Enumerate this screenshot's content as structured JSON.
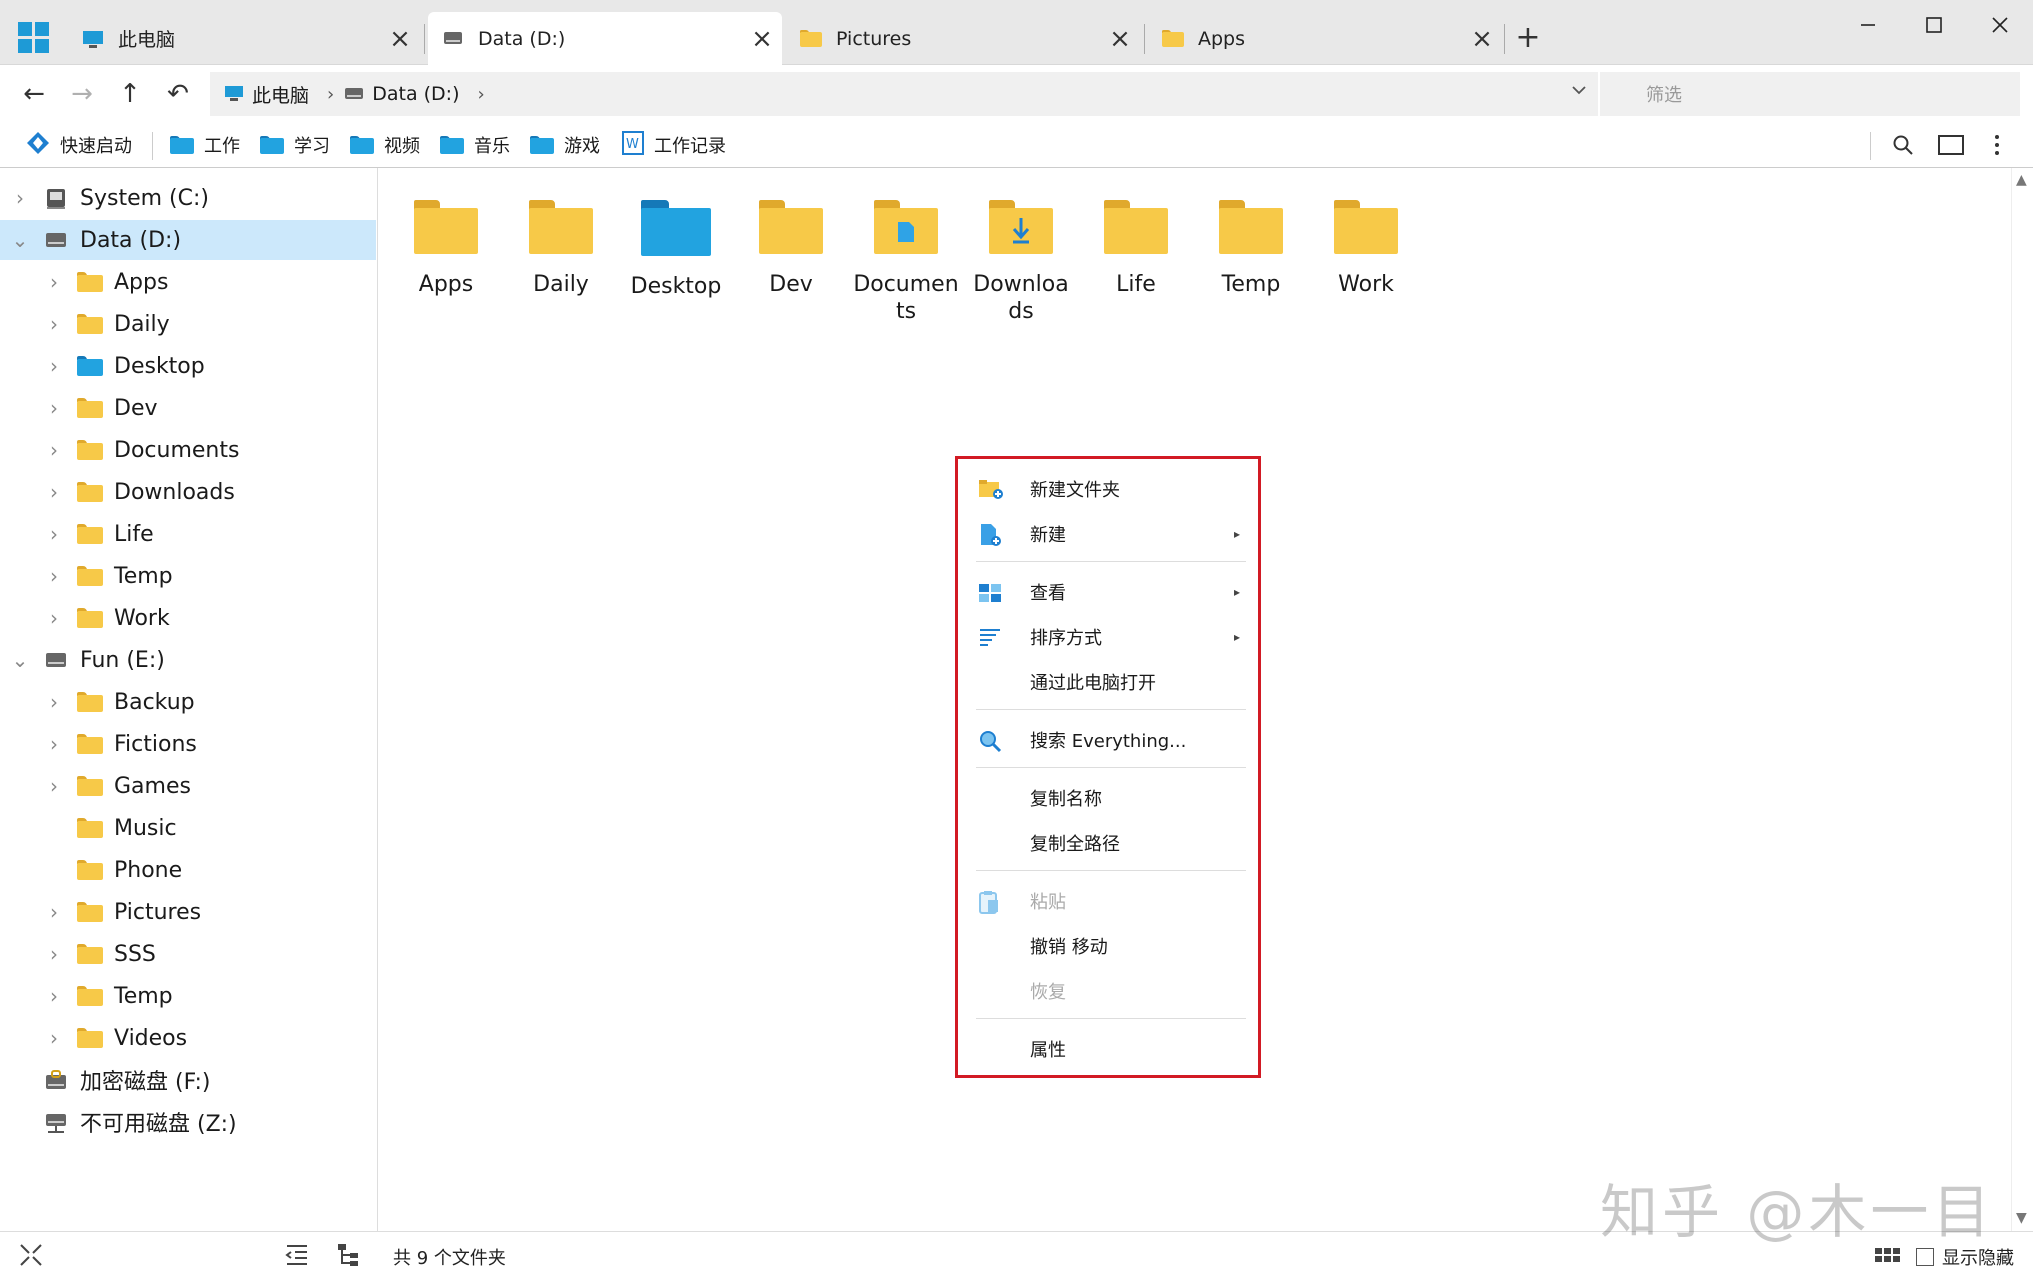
{
  "tabs": [
    {
      "label": "此电脑",
      "icon": "computer-icon"
    },
    {
      "label": "Data (D:)",
      "icon": "drive-icon"
    },
    {
      "label": "Pictures",
      "icon": "pictures-folder-icon"
    },
    {
      "label": "Apps",
      "icon": "folder-icon"
    }
  ],
  "window": {
    "minimize": "—",
    "maximize": "☐",
    "close": "✕",
    "new_tab": "+"
  },
  "nav": {
    "back": "←",
    "forward": "→",
    "up": "↑",
    "undo": "↶"
  },
  "address": {
    "crumbs": [
      "此电脑",
      "Data (D:)"
    ],
    "sep": "›",
    "dropdown": "⌄"
  },
  "filter": {
    "placeholder": "筛选"
  },
  "quickbar": {
    "launch": "快速启动",
    "items": [
      "工作",
      "学习",
      "视频",
      "音乐",
      "游戏",
      "工作记录"
    ]
  },
  "sidebar": {
    "nodes": [
      {
        "label": "System (C:)"
      },
      {
        "label": "Data (D:)"
      },
      {
        "label": "Apps"
      },
      {
        "label": "Daily"
      },
      {
        "label": "Desktop"
      },
      {
        "label": "Dev"
      },
      {
        "label": "Documents"
      },
      {
        "label": "Downloads"
      },
      {
        "label": "Life"
      },
      {
        "label": "Temp"
      },
      {
        "label": "Work"
      },
      {
        "label": "Fun (E:)"
      },
      {
        "label": "Backup"
      },
      {
        "label": "Fictions"
      },
      {
        "label": "Games"
      },
      {
        "label": "Music"
      },
      {
        "label": "Phone"
      },
      {
        "label": "Pictures"
      },
      {
        "label": "SSS"
      },
      {
        "label": "Temp"
      },
      {
        "label": "Videos"
      },
      {
        "label": "加密磁盘 (F:)"
      },
      {
        "label": "不可用磁盘 (Z:)"
      }
    ]
  },
  "files": [
    {
      "line1": "Apps",
      "line2": ""
    },
    {
      "line1": "Daily",
      "line2": ""
    },
    {
      "line1": "Desktop",
      "line2": ""
    },
    {
      "line1": "Dev",
      "line2": ""
    },
    {
      "line1": "Documen",
      "line2": "ts"
    },
    {
      "line1": "Downloa",
      "line2": "ds"
    },
    {
      "line1": "Life",
      "line2": ""
    },
    {
      "line1": "Temp",
      "line2": ""
    },
    {
      "line1": "Work",
      "line2": ""
    }
  ],
  "context_menu": {
    "items": [
      {
        "label": "新建文件夹"
      },
      {
        "label": "新建"
      },
      {
        "label": "查看"
      },
      {
        "label": "排序方式"
      },
      {
        "label": "通过此电脑打开"
      },
      {
        "label": "搜索 Everything..."
      },
      {
        "label": "复制名称"
      },
      {
        "label": "复制全路径"
      },
      {
        "label": "粘贴"
      },
      {
        "label": "撤销 移动"
      },
      {
        "label": "恢复"
      },
      {
        "label": "属性"
      }
    ],
    "arrow": "▸"
  },
  "status": {
    "count": "共 9 个文件夹",
    "show_hidden": "显示隐藏"
  },
  "watermark": "知乎 @木一目",
  "colors": {
    "accent": "#1e9ad6",
    "selection": "#cce8fb",
    "folder": "#f7c948",
    "highlight_border": "#d21a24"
  }
}
